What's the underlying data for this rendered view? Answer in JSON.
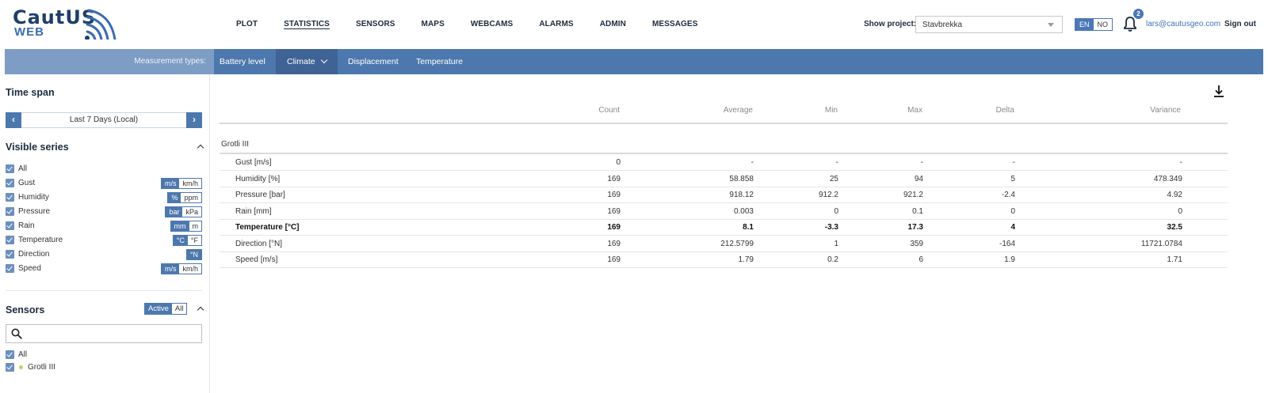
{
  "header": {
    "logo_main": "CautUS",
    "logo_sub": "WEB",
    "nav": [
      {
        "label": "PLOT"
      },
      {
        "label": "STATISTICS",
        "active": true
      },
      {
        "label": "SENSORS"
      },
      {
        "label": "MAPS"
      },
      {
        "label": "WEBCAMS"
      },
      {
        "label": "ALARMS"
      },
      {
        "label": "ADMIN"
      },
      {
        "label": "MESSAGES"
      }
    ],
    "project_label": "Show project:",
    "project_value": "Stavbrekka",
    "lang_en": "EN",
    "lang_no": "NO",
    "active_lang": "EN",
    "notification_count": "2",
    "user_email": "lars@cautusgeo.com",
    "sign_out": "Sign out"
  },
  "measurement_bar": {
    "label": "Measurement types:",
    "tabs": [
      "Battery level",
      "Climate",
      "Displacement",
      "Temperature"
    ],
    "active_tab": "Climate"
  },
  "sidebar": {
    "timespan_title": "Time span",
    "timespan_value": "Last 7 Days (Local)",
    "prev_symbol": "‹",
    "next_symbol": "›",
    "visible_series_title": "Visible series",
    "series": [
      {
        "label": "All",
        "checked": true
      },
      {
        "label": "Gust",
        "checked": true,
        "units": [
          "m/s",
          "km/h"
        ],
        "active_unit": "m/s"
      },
      {
        "label": "Humidity",
        "checked": true,
        "units": [
          "%",
          "ppm"
        ],
        "active_unit": "%"
      },
      {
        "label": "Pressure",
        "checked": true,
        "units": [
          "bar",
          "kPa"
        ],
        "active_unit": "bar"
      },
      {
        "label": "Rain",
        "checked": true,
        "units": [
          "mm",
          "m"
        ],
        "active_unit": "mm"
      },
      {
        "label": "Temperature",
        "checked": true,
        "units": [
          "°C",
          "°F"
        ],
        "active_unit": "°C"
      },
      {
        "label": "Direction",
        "checked": true,
        "units": [
          "°N"
        ],
        "active_unit": "°N"
      },
      {
        "label": "Speed",
        "checked": true,
        "units": [
          "m/s",
          "km/h"
        ],
        "active_unit": "m/s"
      }
    ],
    "sensors_title": "Sensors",
    "sensor_filter": {
      "active": "Active",
      "all": "All",
      "selected": "Active"
    },
    "search_placeholder": "",
    "sensors": [
      {
        "label": "All",
        "checked": true
      },
      {
        "label": "Grotli III",
        "checked": true,
        "status_color": "#b9d36b"
      }
    ]
  },
  "table": {
    "columns": [
      "Count",
      "Average",
      "Min",
      "Max",
      "Delta",
      "Variance"
    ],
    "group": "Grotli III",
    "rows": [
      {
        "name": "Gust [m/s]",
        "values": [
          "0",
          "-",
          "-",
          "-",
          "-",
          "-"
        ],
        "bold": false
      },
      {
        "name": "Humidity [%]",
        "values": [
          "169",
          "58.858",
          "25",
          "94",
          "5",
          "478.349"
        ],
        "bold": false
      },
      {
        "name": "Pressure [bar]",
        "values": [
          "169",
          "918.12",
          "912.2",
          "921.2",
          "-2.4",
          "4.92"
        ],
        "bold": false
      },
      {
        "name": "Rain [mm]",
        "values": [
          "169",
          "0.003",
          "0",
          "0.1",
          "0",
          "0"
        ],
        "bold": false
      },
      {
        "name": "Temperature [°C]",
        "values": [
          "169",
          "8.1",
          "-3.3",
          "17.3",
          "4",
          "32.5"
        ],
        "bold": true
      },
      {
        "name": "Direction [°N]",
        "values": [
          "169",
          "212.5799",
          "1",
          "359",
          "-164",
          "11721.0784"
        ],
        "bold": false
      },
      {
        "name": "Speed [m/s]",
        "values": [
          "169",
          "1.79",
          "0.2",
          "6",
          "1.9",
          "1.71"
        ],
        "bold": false
      }
    ]
  },
  "colors": {
    "accent": "#4d78ad",
    "accent_dark": "#3e6394",
    "nav_text": "#1c2a3c",
    "link": "#3f73b8"
  }
}
